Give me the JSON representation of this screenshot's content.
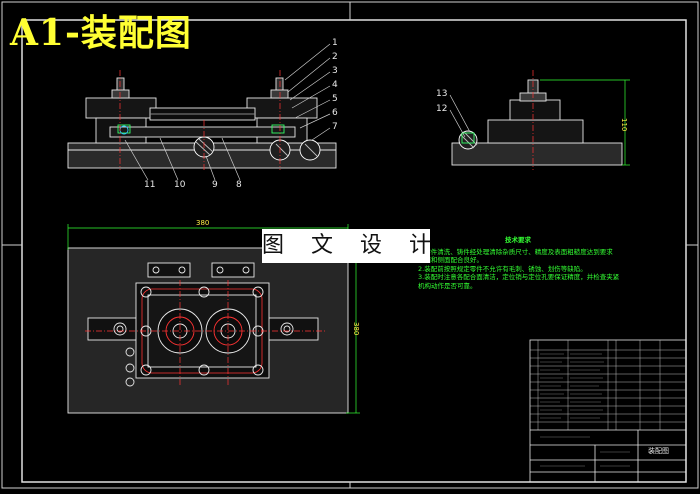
{
  "title": "A1-装配图",
  "overlay_label": "图 文 设 计",
  "part_numbers": [
    "1",
    "2",
    "3",
    "4",
    "5",
    "6",
    "7",
    "8",
    "9",
    "10",
    "11",
    "12",
    "13"
  ],
  "dimensions": {
    "width": "380",
    "height": "380",
    "side_height": "110"
  },
  "tech_notes": {
    "heading": "技术要求",
    "lines": [
      "1.零件清洗、铸件经处理清除杂质尺寸、精度及表面粗糙度达到要求",
      "顶面和侧面配合良好。",
      "2.装配前按照规定零件不允许有毛刺、锈蚀、划伤等缺陷。",
      "3.装配时注意各配合面清洁，定位销与定位孔要保证精度，并检查夹紧",
      "机构动作是否可靠。"
    ]
  },
  "title_block": {
    "drawing_name": "装配图"
  },
  "colors": {
    "title": "#ffff33",
    "lines": "#e8e8e8",
    "notes": "#33ff33",
    "centerline": "#ff3333",
    "dimension": "#33ff33",
    "part": "#ffffff"
  }
}
